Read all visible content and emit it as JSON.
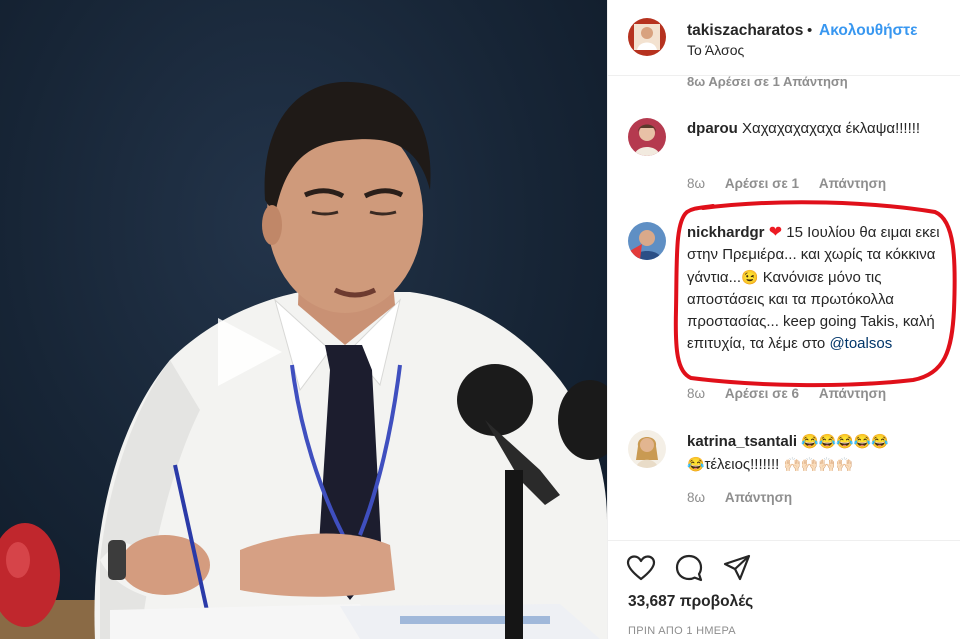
{
  "header": {
    "username": "takiszacharatos",
    "separator": "•",
    "follow_label": "Ακολουθήστε",
    "location": "Το Άλσος"
  },
  "cut_comment_meta": "8ω   Αρέσει σε 1   Απάντηση",
  "comments": [
    {
      "username": "dparou",
      "text": "Χαχαχαχαχαχα έκλαψα!!!!!!",
      "time": "8ω",
      "likes": "Αρέσει σε 1",
      "reply_label": "Απάντηση"
    },
    {
      "username": "nickhardgr",
      "heart": "❤",
      "text_part1": " 15 Ιουλίου θα ειμαι εκει στην Πρεμιέρα... και χωρίς τα κόκκινα γάντια...",
      "emoji": "😉",
      "text_part2": " Κανόνισε μόνο τις αποστάσεις και τα πρωτόκολλα προστασίας... keep going Takis, καλή επιτυχία, τα λέμε στο ",
      "mention": "@toalsos",
      "time": "8ω",
      "likes": "Αρέσει σε 6",
      "reply_label": "Απάντηση"
    },
    {
      "username": "katrina_tsantali",
      "emojis_1": "😂😂😂😂😂",
      "emojis_2": "😂",
      "text": "τέλειος!!!!!!! ",
      "emojis_3": "🙌🏻🙌🏻🙌🏻🙌🏻",
      "time": "8ω",
      "reply_label": "Απάντηση"
    }
  ],
  "actions": {
    "icons": [
      "heart-icon",
      "comment-icon",
      "share-icon"
    ],
    "views": "33,687 προβολές",
    "posted": "ΠΡΙΝ ΑΠΟ 1 ΗΜΕΡΑ"
  },
  "media": {
    "type": "video",
    "play_icon": "play-icon"
  },
  "colors": {
    "link_blue": "#3897f0",
    "highlight_red": "#e0101a",
    "meta_gray": "#8e8e8e",
    "text": "#262626"
  }
}
